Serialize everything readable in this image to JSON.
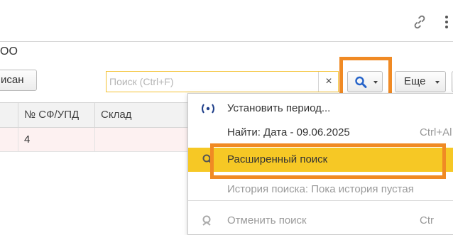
{
  "header": {
    "title_fragment": "ОО",
    "link_icon": "link-icon",
    "more_icon": "vertical-dots-icon"
  },
  "toolbar": {
    "podpisan_label": "исан",
    "search_placeholder": "Поиск (Ctrl+F)",
    "clear_symbol": "×",
    "search_icon": "magnifier-icon",
    "more_label": "Еще"
  },
  "table": {
    "columns": [
      "№ СФ/УПД",
      "Склад"
    ],
    "rows": [
      {
        "sf": "4",
        "sklad": ""
      }
    ]
  },
  "menu": {
    "items": [
      {
        "label": "Установить период...",
        "shortcut": "",
        "icon": "period-icon",
        "enabled": true
      },
      {
        "label": "Найти: Дата - 09.06.2025",
        "shortcut": "Ctrl+Al",
        "icon": "",
        "enabled": true
      },
      {
        "label": "Расширенный поиск",
        "shortcut": "",
        "icon": "advanced-search-icon",
        "enabled": true,
        "highlighted": true
      },
      {
        "label": "История поиска: Пока история пустая",
        "shortcut": "",
        "icon": "",
        "enabled": false
      },
      {
        "label": "Отменить поиск",
        "shortcut": "Ctr",
        "icon": "cancel-search-icon",
        "enabled": false
      }
    ]
  },
  "colors": {
    "highlight_menu": "#f6c825",
    "annotation_frame": "#f08a24",
    "search_border": "#f4c233",
    "row_bg": "#fdf1f1"
  }
}
